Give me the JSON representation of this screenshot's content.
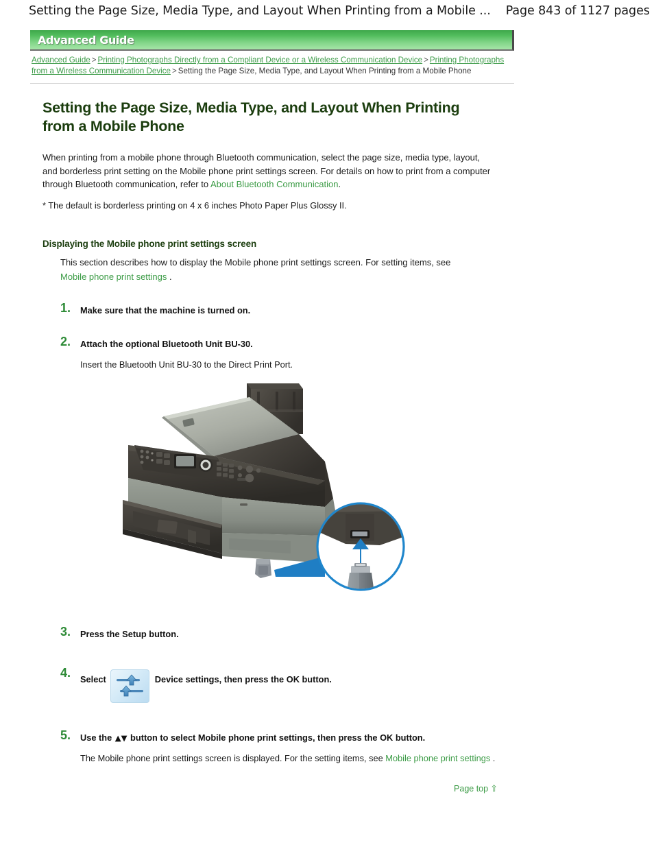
{
  "page_header": {
    "title": "Setting the Page Size, Media Type, and Layout When Printing from a Mobile ...",
    "pages": "Page 843 of 1127 pages"
  },
  "banner": {
    "label": "Advanced Guide",
    "gradient_top": "#3fa84b",
    "gradient_bottom": "#a6e5a8"
  },
  "breadcrumb": {
    "items": [
      {
        "label": "Advanced Guide",
        "link": true
      },
      {
        "label": "Printing Photographs Directly from a Compliant Device or a Wireless Communication Device",
        "link": true
      },
      {
        "label": "Printing Photographs from a Wireless Communication Device",
        "link": true
      },
      {
        "label": "Setting the Page Size, Media Type, and Layout When Printing from a Mobile Phone",
        "link": false
      }
    ],
    "separator": ">",
    "link_color": "#3c9b48",
    "current_color": "#333333"
  },
  "main": {
    "title": "Setting the Page Size, Media Type, and Layout When Printing from a Mobile Phone",
    "title_color": "#1b3d0e",
    "intro_part1": "When printing from a mobile phone through Bluetooth communication, select the page size, media type, layout, and borderless print setting on the Mobile phone print settings screen. For details on how to print from a computer through Bluetooth communication, refer to ",
    "intro_link": "About Bluetooth Communication",
    "intro_part2": ".",
    "note": "* The default is borderless printing on 4 x 6 inches Photo Paper Plus Glossy II.",
    "section_heading": "Displaying the Mobile phone print settings screen",
    "section_desc_part1": "This section describes how to display the Mobile phone print settings screen. For setting items, see ",
    "section_desc_link": "Mobile phone print settings",
    "section_desc_part2": " ."
  },
  "steps": [
    {
      "number": "1.",
      "headline": "Make sure that the machine is turned on."
    },
    {
      "number": "2.",
      "headline": "Attach the optional Bluetooth Unit BU-30.",
      "subtext": "Insert the Bluetooth Unit BU-30 to the Direct Print Port."
    },
    {
      "number": "3.",
      "headline": "Press the Setup button."
    },
    {
      "number": "4.",
      "headline_before": "Select",
      "icon": "device-settings-icon",
      "headline_after": "Device settings, then press the OK button."
    },
    {
      "number": "5.",
      "headline_before": "Use the ",
      "arrows": "▲▼",
      "headline_after": " button to select Mobile phone print settings, then press the ",
      "headline_tail": "OK button.",
      "subtext_part1": "The Mobile phone print settings screen is displayed. For the setting items, see ",
      "subtext_link": "Mobile phone print settings",
      "subtext_part2": " ."
    }
  ],
  "figure": {
    "name": "printer-bluetooth-illustration",
    "callout_color": "#1f7ec4"
  },
  "footer": {
    "page_top_label": "Page top",
    "page_top_arrow": "⇧",
    "color": "#3b9b45"
  },
  "step_number_color": "#2e8b37"
}
